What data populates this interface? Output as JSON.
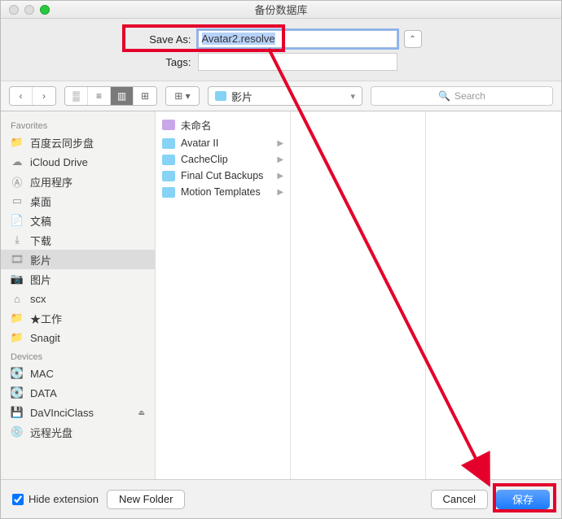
{
  "window": {
    "title": "备份数据库"
  },
  "saveas": {
    "label": "Save As:",
    "value": "Avatar2.resolve",
    "tags_label": "Tags:"
  },
  "toolbar": {
    "path_label": "影片",
    "search_placeholder": "Search"
  },
  "sidebar": {
    "favorites_header": "Favorites",
    "devices_header": "Devices",
    "favorites": [
      {
        "label": "百度云同步盘",
        "icon": "folder"
      },
      {
        "label": "iCloud Drive",
        "icon": "cloud"
      },
      {
        "label": "应用程序",
        "icon": "apps"
      },
      {
        "label": "桌面",
        "icon": "desktop"
      },
      {
        "label": "文稿",
        "icon": "doc"
      },
      {
        "label": "下载",
        "icon": "download"
      },
      {
        "label": "影片",
        "icon": "movie",
        "selected": true
      },
      {
        "label": "图片",
        "icon": "camera"
      },
      {
        "label": "scx",
        "icon": "home"
      },
      {
        "label": "★工作",
        "icon": "folder"
      },
      {
        "label": "Snagit",
        "icon": "folder"
      }
    ],
    "devices": [
      {
        "label": "MAC",
        "icon": "disk"
      },
      {
        "label": "DATA",
        "icon": "disk"
      },
      {
        "label": "DaVInciClass",
        "icon": "ext",
        "eject": true
      },
      {
        "label": "远程光盘",
        "icon": "remote"
      }
    ]
  },
  "files": {
    "col1": [
      {
        "label": "未命名",
        "type": "mov"
      },
      {
        "label": "Avatar II",
        "type": "fold",
        "arrow": true
      },
      {
        "label": "CacheClip",
        "type": "fold",
        "arrow": true
      },
      {
        "label": "Final Cut Backups",
        "type": "fold",
        "arrow": true
      },
      {
        "label": "Motion Templates",
        "type": "fold",
        "arrow": true
      }
    ]
  },
  "footer": {
    "hide_ext": "Hide extension",
    "new_folder": "New Folder",
    "cancel": "Cancel",
    "save": "保存"
  }
}
